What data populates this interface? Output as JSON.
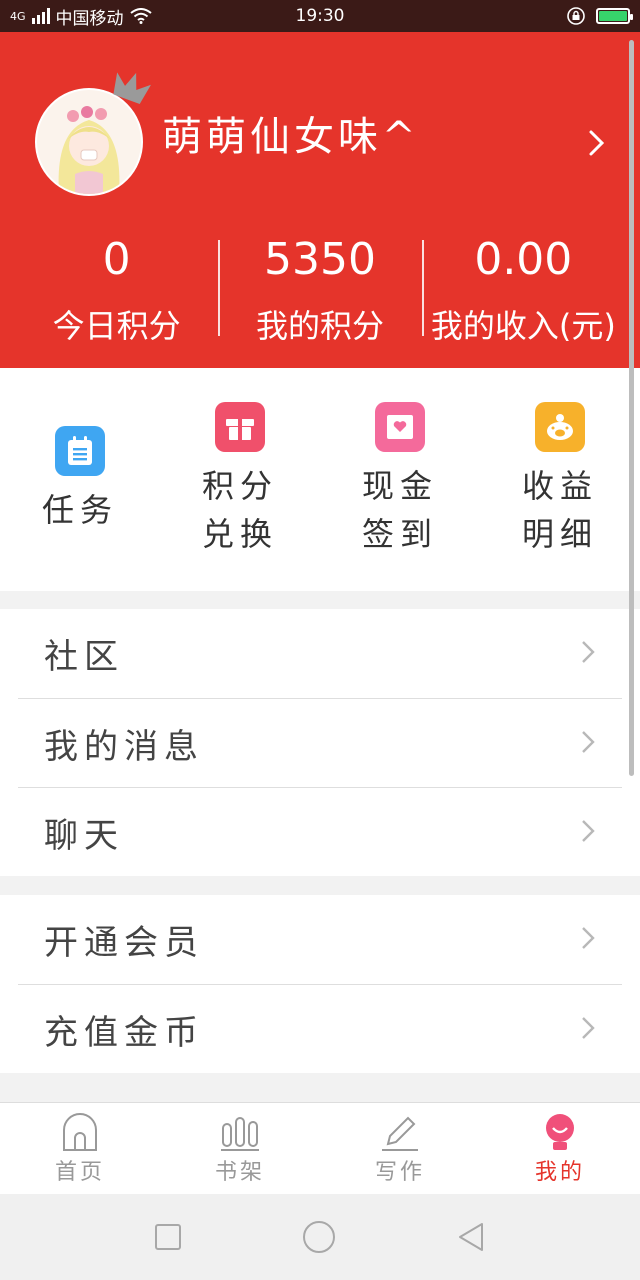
{
  "status_bar": {
    "network": "4G",
    "carrier": "中国移动",
    "time": "19:30"
  },
  "profile": {
    "nickname": "萌萌仙女味^",
    "stats": [
      {
        "value": "0",
        "label": "今日积分"
      },
      {
        "value": "5350",
        "label": "我的积分"
      },
      {
        "value": "0.00",
        "label": "我的收入(元)"
      }
    ]
  },
  "actions": [
    {
      "label": "任务",
      "icon": "task-icon",
      "color": "#3fa6f2"
    },
    {
      "label": "积分兑换",
      "icon": "gift-icon",
      "color": "#f0506b"
    },
    {
      "label": "现金签到",
      "icon": "heart-envelope-icon",
      "color": "#f46a9b"
    },
    {
      "label": "收益明细",
      "icon": "piggy-bank-icon",
      "color": "#f7b12b"
    }
  ],
  "menu_group_1": [
    {
      "label": "社区"
    },
    {
      "label": "我的消息"
    },
    {
      "label": "聊天"
    }
  ],
  "menu_group_2": [
    {
      "label": "开通会员"
    },
    {
      "label": "充值金币"
    }
  ],
  "tabbar": {
    "tabs": [
      {
        "label": "首页",
        "icon": "home-icon"
      },
      {
        "label": "书架",
        "icon": "bookshelf-icon"
      },
      {
        "label": "写作",
        "icon": "pen-icon"
      },
      {
        "label": "我的",
        "icon": "user-icon"
      }
    ],
    "active_index": 3,
    "active_color": "#e5342b"
  },
  "colors": {
    "brand": "#e5342b",
    "background": "#f2f2f2"
  }
}
